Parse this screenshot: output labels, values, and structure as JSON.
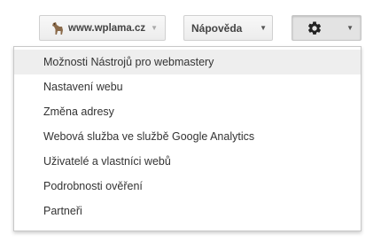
{
  "toolbar": {
    "site_button": {
      "icon": "dog-icon",
      "label": "www.wplama.cz"
    },
    "help_button": {
      "label": "Nápověda"
    },
    "settings_button": {
      "icon": "gear-icon"
    }
  },
  "settings_menu": {
    "items": [
      {
        "label": "Možnosti Nástrojů pro webmastery",
        "highlighted": true
      },
      {
        "label": "Nastavení webu"
      },
      {
        "label": "Změna adresy"
      },
      {
        "label": "Webová služba ve službě Google Analytics"
      },
      {
        "label": "Uživatelé a vlastníci webů"
      },
      {
        "label": "Podrobnosti ověření"
      },
      {
        "label": "Partneři"
      }
    ]
  },
  "colors": {
    "menu_highlight": "#eeeeee",
    "text": "#333333"
  }
}
